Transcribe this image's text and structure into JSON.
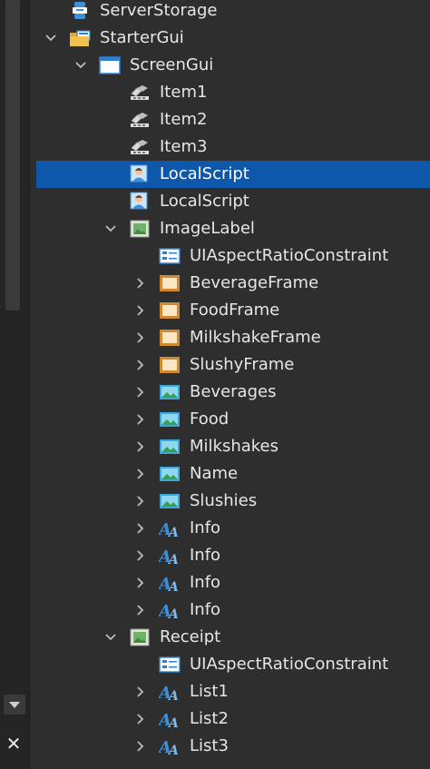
{
  "explorer": {
    "items": [
      {
        "label": "ServerStorage",
        "icon": "server-storage-icon",
        "chevron": "none"
      },
      {
        "label": "StarterGui",
        "icon": "folder-gui-icon",
        "chevron": "down"
      },
      {
        "label": "ScreenGui",
        "icon": "screen-gui-icon",
        "chevron": "down"
      },
      {
        "label": "Item1",
        "icon": "tool-icon",
        "chevron": "none"
      },
      {
        "label": "Item2",
        "icon": "tool-icon",
        "chevron": "none"
      },
      {
        "label": "Item3",
        "icon": "tool-icon",
        "chevron": "none"
      },
      {
        "label": "LocalScript",
        "icon": "local-script-icon",
        "chevron": "none",
        "selected": true
      },
      {
        "label": "LocalScript",
        "icon": "local-script-icon",
        "chevron": "none"
      },
      {
        "label": "ImageLabel",
        "icon": "image-label-icon",
        "chevron": "down"
      },
      {
        "label": "UIAspectRatioConstraint",
        "icon": "constraint-icon",
        "chevron": "none"
      },
      {
        "label": "BeverageFrame",
        "icon": "frame-icon",
        "chevron": "right"
      },
      {
        "label": "FoodFrame",
        "icon": "frame-icon",
        "chevron": "right"
      },
      {
        "label": "MilkshakeFrame",
        "icon": "frame-icon",
        "chevron": "right"
      },
      {
        "label": "SlushyFrame",
        "icon": "frame-icon",
        "chevron": "right"
      },
      {
        "label": "Beverages",
        "icon": "image-button-icon",
        "chevron": "right"
      },
      {
        "label": "Food",
        "icon": "image-button-icon",
        "chevron": "right"
      },
      {
        "label": "Milkshakes",
        "icon": "image-button-icon",
        "chevron": "right"
      },
      {
        "label": "Name",
        "icon": "image-button-icon",
        "chevron": "right"
      },
      {
        "label": "Slushies",
        "icon": "image-button-icon",
        "chevron": "right"
      },
      {
        "label": "Info",
        "icon": "text-label-icon",
        "chevron": "right"
      },
      {
        "label": "Info",
        "icon": "text-label-icon",
        "chevron": "right"
      },
      {
        "label": "Info",
        "icon": "text-label-icon",
        "chevron": "right"
      },
      {
        "label": "Info",
        "icon": "text-label-icon",
        "chevron": "right"
      },
      {
        "label": "Receipt",
        "icon": "image-label-icon",
        "chevron": "down"
      },
      {
        "label": "UIAspectRatioConstraint",
        "icon": "constraint-icon",
        "chevron": "none"
      },
      {
        "label": "List1",
        "icon": "text-label-icon",
        "chevron": "right"
      },
      {
        "label": "List2",
        "icon": "text-label-icon",
        "chevron": "right"
      },
      {
        "label": "List3",
        "icon": "text-label-icon",
        "chevron": "right"
      }
    ]
  },
  "colors": {
    "background": "#2e2e2e",
    "selection": "#0e58ac",
    "text": "#e6e6e6"
  }
}
